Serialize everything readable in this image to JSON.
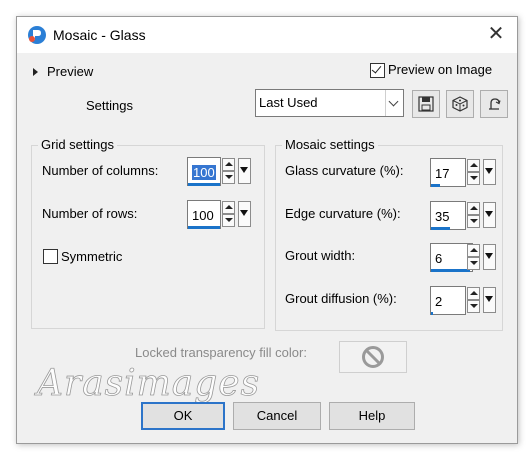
{
  "window": {
    "title": "Mosaic - Glass"
  },
  "preview": {
    "label": "Preview",
    "on_image_label": "Preview on Image",
    "on_image_checked": true
  },
  "settings": {
    "label": "Settings",
    "preset": "Last Used"
  },
  "grid_settings": {
    "title": "Grid settings",
    "columns": {
      "label": "Number of columns:",
      "value": "100"
    },
    "rows": {
      "label": "Number of rows:",
      "value": "100"
    },
    "symmetric": {
      "label": "Symmetric",
      "checked": false
    }
  },
  "mosaic_settings": {
    "title": "Mosaic settings",
    "glass_curvature": {
      "label": "Glass curvature (%):",
      "value": "17"
    },
    "edge_curvature": {
      "label": "Edge curvature (%):",
      "value": "35"
    },
    "grout_width": {
      "label": "Grout width:",
      "value": "6"
    },
    "grout_diffusion": {
      "label": "Grout diffusion (%):",
      "value": "2"
    }
  },
  "locked": {
    "label": "Locked transparency fill color:"
  },
  "watermark": "Arasimages",
  "buttons": {
    "ok": "OK",
    "cancel": "Cancel",
    "help": "Help"
  },
  "colors": {
    "accent": "#1a73c9",
    "selection": "#3676d1",
    "dialog_bg": "#f0f0f0"
  }
}
